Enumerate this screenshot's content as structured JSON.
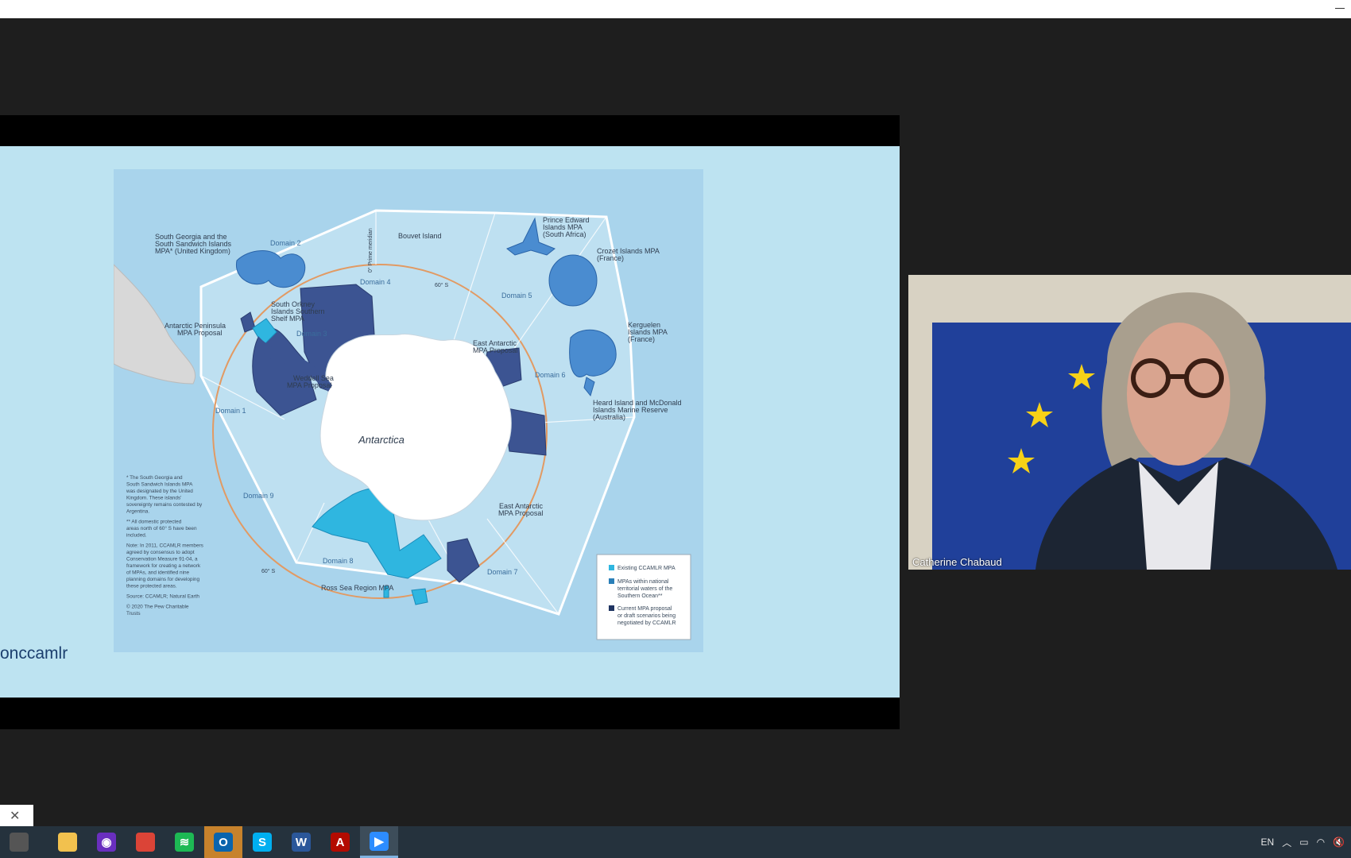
{
  "window": {
    "minimize_label": "–"
  },
  "slide": {
    "handle_text": "onccamlr",
    "map": {
      "continent": "Antarctica",
      "labels": {
        "south_georgia": [
          "South Georgia and the",
          "South Sandwich Islands",
          "MPA* (United Kingdom)"
        ],
        "domain2": "Domain 2",
        "prime_meridian": "0° Prime meridian",
        "bouvet": "Bouvet Island",
        "prince_edward": [
          "Prince Edward",
          "Islands MPA",
          "(South Africa)"
        ],
        "crozet": [
          "Crozet Islands MPA",
          "(France)"
        ],
        "domain4": "Domain 4",
        "lat60_top": "60° S",
        "domain5": "Domain 5",
        "south_orkney": [
          "South Orkney",
          "Islands Southern",
          "Shelf MPA"
        ],
        "antarctic_peninsula": [
          "Antarctic Peninsula",
          "MPA Proposal"
        ],
        "domain3": "Domain 3",
        "kerguelen": [
          "Kerguelen",
          "Islands MPA",
          "(France)"
        ],
        "east_antarctic_top": [
          "East Antarctic",
          "MPA Proposal"
        ],
        "domain6": "Domain 6",
        "weddell": [
          "Weddell Sea",
          "MPA Proposal"
        ],
        "heard": [
          "Heard Island and McDonald",
          "Islands Marine Reserve",
          "(Australia)"
        ],
        "domain1": "Domain 1",
        "domain9": "Domain 9",
        "east_antarctic_bottom": [
          "East Antarctic",
          "MPA Proposal"
        ],
        "domain8": "Domain 8",
        "lat60_bottom": "60° S",
        "ross_sea": "Ross Sea Region MPA",
        "domain7": "Domain 7"
      },
      "notes": [
        "* The South Georgia and",
        "South Sandwich Islands MPA",
        "was designated by the United",
        "Kingdom. These islands'",
        "sovereignty remains contested by",
        "Argentina.",
        "** All domestic protected",
        "areas north of 60° S have been",
        "included.",
        "Note: In 2011, CCAMLR members",
        "agreed by consensus to adopt",
        "Conservation Measure 91-04, a",
        "framework for creating a network",
        "of MPAs, and identified nine",
        "planning domains for developing",
        "these protected areas.",
        "Source: CCAMLR; Natural Earth",
        "© 2020 The Pew Charitable",
        "Trusts"
      ],
      "legend": [
        {
          "lines": [
            "Existing CCAMLR MPA"
          ],
          "color": "#2fb6e0"
        },
        {
          "lines": [
            "MPAs within national",
            "territorial waters of the",
            "Southern Ocean**"
          ],
          "color": "#2a7fb8"
        },
        {
          "lines": [
            "Current MPA proposal",
            "or draft scenarios being",
            "negotiated by CCAMLR"
          ],
          "color": "#1f3462"
        }
      ]
    }
  },
  "video": {
    "participant_name": "Catherine Chabaud"
  },
  "notification": {
    "close_glyph": "✕"
  },
  "taskbar": {
    "apps": [
      {
        "name": "app-screenshot-icon",
        "glyph": "",
        "color": "#555555"
      },
      {
        "name": "file-explorer-icon",
        "glyph": "",
        "color": "#f2c14e"
      },
      {
        "name": "podcast-icon",
        "glyph": "◉",
        "color": "#6a2fbf"
      },
      {
        "name": "chrome-icon",
        "glyph": "",
        "color": "#db4437"
      },
      {
        "name": "spotify-icon",
        "glyph": "≋",
        "color": "#1db954"
      },
      {
        "name": "outlook-icon",
        "glyph": "O",
        "color": "#0a64ad"
      },
      {
        "name": "skype-icon",
        "glyph": "S",
        "color": "#00aff0"
      },
      {
        "name": "word-icon",
        "glyph": "W",
        "color": "#2b579a"
      },
      {
        "name": "acrobat-icon",
        "glyph": "A",
        "color": "#b30b00"
      },
      {
        "name": "zoom-icon",
        "glyph": "▶",
        "color": "#2d8cff"
      }
    ],
    "language": "EN"
  }
}
